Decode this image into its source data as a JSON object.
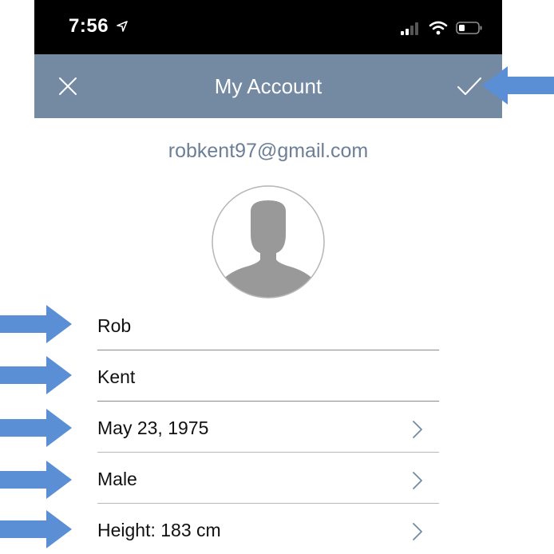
{
  "status_bar": {
    "time": "7:56",
    "location_icon": "location-arrow-icon",
    "signal_icon": "cellular-signal-icon",
    "wifi_icon": "wifi-icon",
    "battery_icon": "battery-icon"
  },
  "nav": {
    "title": "My Account",
    "close_icon": "close-icon",
    "done_icon": "checkmark-icon"
  },
  "account": {
    "email": "robkent97@gmail.com",
    "avatar_icon": "profile-silhouette-icon"
  },
  "fields": [
    {
      "value": "Rob",
      "has_chevron": false
    },
    {
      "value": "Kent",
      "has_chevron": false
    },
    {
      "value": "May 23, 1975",
      "has_chevron": true
    },
    {
      "value": "Male",
      "has_chevron": true
    },
    {
      "value": "Height: 183 cm",
      "has_chevron": true
    }
  ],
  "colors": {
    "nav_bar": "#7489a2",
    "email_text": "#6c7f97",
    "annotation_arrow": "#5a8fd6",
    "avatar_fill": "#999999"
  },
  "annotation_icon": "pointer-arrow-icon"
}
